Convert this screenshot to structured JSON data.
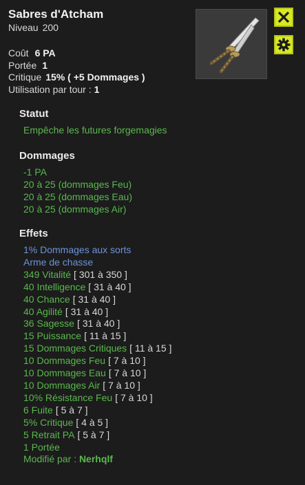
{
  "item": {
    "name": "Sabres d'Atcham",
    "level_label": "Niveau",
    "level_value": "200"
  },
  "stats": {
    "cost_label": "Coût",
    "cost_value": "6 PA",
    "range_label": "Portée",
    "range_value": "1",
    "crit_label": "Critique",
    "crit_value": "15% ( +5 Dommages )",
    "uses_label": "Utilisation par tour :",
    "uses_value": "1"
  },
  "buttons": {
    "close_icon": "close-x",
    "settings_icon": "gear"
  },
  "colors": {
    "accent_button": "#d7e824",
    "green_text": "#5ab84e",
    "blue_text": "#6c93d8"
  },
  "statut": {
    "title": "Statut",
    "lines": [
      "Empêche les futures forgemagies"
    ]
  },
  "dommages": {
    "title": "Dommages",
    "lines": [
      "-1 PA",
      "20 à 25 (dommages Feu)",
      "20 à 25 (dommages Eau)",
      "20 à 25 (dommages Air)"
    ]
  },
  "effets": {
    "title": "Effets",
    "blue_lines": [
      "1% Dommages aux sorts",
      "Arme de chasse"
    ],
    "lines": [
      {
        "text": "349 Vitalité",
        "range": "[ 301 à 350 ]"
      },
      {
        "text": "40 Intelligence",
        "range": "[ 31 à 40 ]"
      },
      {
        "text": "40 Chance",
        "range": "[ 31 à 40 ]"
      },
      {
        "text": "40 Agilité",
        "range": "[ 31 à 40 ]"
      },
      {
        "text": "36 Sagesse",
        "range": "[ 31 à 40 ]"
      },
      {
        "text": "15 Puissance",
        "range": "[ 11 à 15 ]"
      },
      {
        "text": "15 Dommages Critiques",
        "range": "[ 11 à 15 ]"
      },
      {
        "text": "10 Dommages Feu",
        "range": "[ 7 à 10 ]"
      },
      {
        "text": "10 Dommages Eau",
        "range": "[ 7 à 10 ]"
      },
      {
        "text": "10 Dommages Air",
        "range": "[ 7 à 10 ]"
      },
      {
        "text": "10% Résistance Feu",
        "range": "[ 7 à 10 ]"
      },
      {
        "text": "6 Fuite",
        "range": "[ 5 à 7 ]"
      },
      {
        "text": "5% Critique",
        "range": "[ 4 à 5 ]"
      },
      {
        "text": "5 Retrait PA",
        "range": "[ 5 à 7 ]"
      },
      {
        "text": "1 Portée",
        "range": ""
      }
    ],
    "modified_label": "Modifié par :",
    "modified_by": "Nerhqlf"
  }
}
